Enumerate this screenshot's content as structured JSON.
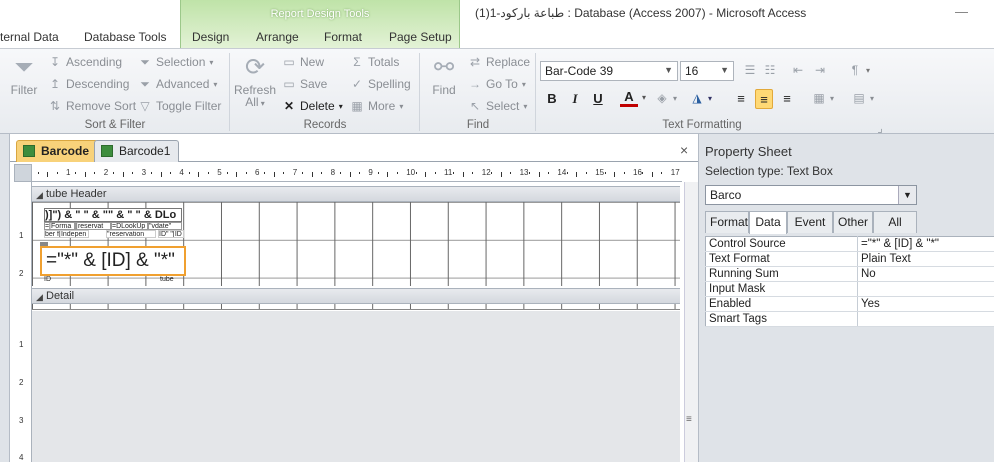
{
  "window": {
    "context_title": "Report Design Tools",
    "title": "طباعة باركود-1(1) : Database (Access 2007)  -  Microsoft Access",
    "minimize_glyph": "—"
  },
  "ribbon_tabs": [
    "ternal Data",
    "Database Tools",
    "Design",
    "Arrange",
    "Format",
    "Page Setup"
  ],
  "ribbon": {
    "sort_filter": {
      "filter": "Filter",
      "ascending": "Ascending",
      "descending": "Descending",
      "remove_sort": "Remove Sort",
      "selection": "Selection",
      "advanced": "Advanced",
      "toggle_filter": "Toggle Filter",
      "label": "Sort & Filter"
    },
    "records": {
      "refresh": "Refresh",
      "refresh_all": "All",
      "new": "New",
      "save": "Save",
      "delete": "Delete",
      "totals": "Totals",
      "spelling": "Spelling",
      "more": "More",
      "label": "Records"
    },
    "find": {
      "find": "Find",
      "replace": "Replace",
      "go_to": "Go To",
      "select": "Select",
      "label": "Find"
    },
    "text_formatting": {
      "font": "Bar-Code 39",
      "size": "16",
      "bold": "B",
      "italic": "I",
      "underline": "U",
      "font_color_glyph": "A",
      "label": "Text Formatting"
    }
  },
  "doc_tabs": {
    "active": "Barcode",
    "other": "Barcode1",
    "close": "×"
  },
  "rulers": {
    "h_ticks": [
      "1",
      "2",
      "3",
      "4",
      "5",
      "6",
      "7",
      "8",
      "9",
      "10",
      "11",
      "12",
      "13",
      "14",
      "15",
      "16",
      "17"
    ],
    "v_ticks_header": [
      "1",
      "2"
    ],
    "v_ticks_detail": [
      "1",
      "2",
      "3",
      "4"
    ]
  },
  "report": {
    "header_section": "tube Header",
    "detail_section": "Detail",
    "controls": {
      "top_text": ")]\") & \" \" & \"\" & \" \" & DLo",
      "small1": "=[Forma",
      "small2": "[reservat",
      "small3": "=DLookUp",
      "small4": "\"vdate\"",
      "small5": "ber f[Indepen",
      "small6": "\"reservation",
      "small7": "ID\" \"[ID",
      "barcode_expr": "=\"*\" & [ID] & \"*\"",
      "id_label": "ID",
      "tube_label": "tube"
    }
  },
  "property_sheet": {
    "title": "Property Sheet",
    "selection_type_label": "Selection type:  Text Box",
    "selected_control": "Barco",
    "tabs": [
      "Format",
      "Data",
      "Event",
      "Other",
      "All"
    ],
    "active_tab": "Data",
    "rows": [
      {
        "name": "Control Source",
        "value": "=\"*\" & [ID] & \"*\""
      },
      {
        "name": "Text Format",
        "value": "Plain Text"
      },
      {
        "name": "Running Sum",
        "value": "No"
      },
      {
        "name": "Input Mask",
        "value": ""
      },
      {
        "name": "Enabled",
        "value": "Yes"
      },
      {
        "name": "Smart Tags",
        "value": ""
      }
    ]
  }
}
